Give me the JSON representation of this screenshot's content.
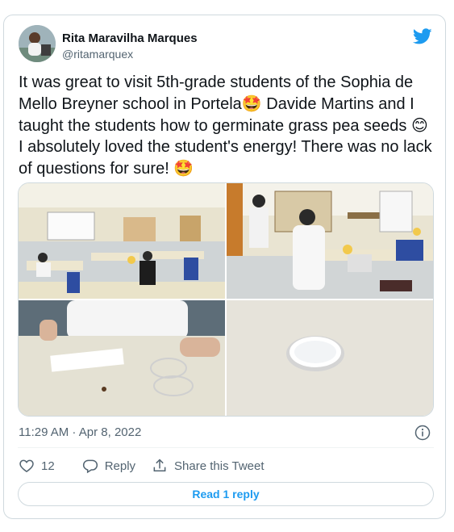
{
  "author": {
    "name": "Rita Maravilha Marques",
    "handle": "@ritamarquex",
    "avatar_icon": "profile-photo"
  },
  "brand_icon": "twitter-bird-icon",
  "colors": {
    "twitter_blue": "#1d9bf0",
    "muted": "#536471",
    "text": "#0f1419",
    "border": "#cfd9de"
  },
  "tweet": {
    "line1": "It was great to visit 5th-grade students of the Sophia de",
    "line2a": "Mello Breyner school in Portela",
    "emoji1": "🤩",
    "line2b": " Davide Martins and I",
    "line3a": "taught the students how to germinate grass pea seeds ",
    "emoji2": "😊",
    "line4": "I absolutely loved the student's energy! There was no lack",
    "line5a": "of questions for sure! ",
    "emoji3": "🤩"
  },
  "media": {
    "photos": [
      {
        "name": "classroom-wide-photo"
      },
      {
        "name": "teacher-with-students-photo"
      },
      {
        "name": "student-dropper-photo"
      },
      {
        "name": "petri-dish-cotton-photo"
      }
    ]
  },
  "meta": {
    "timestamp": "11:29 AM · Apr 8, 2022"
  },
  "actions": {
    "like_count": "12",
    "reply_label": "Reply",
    "share_label": "Share this Tweet"
  },
  "read_reply_label": "Read 1 reply"
}
